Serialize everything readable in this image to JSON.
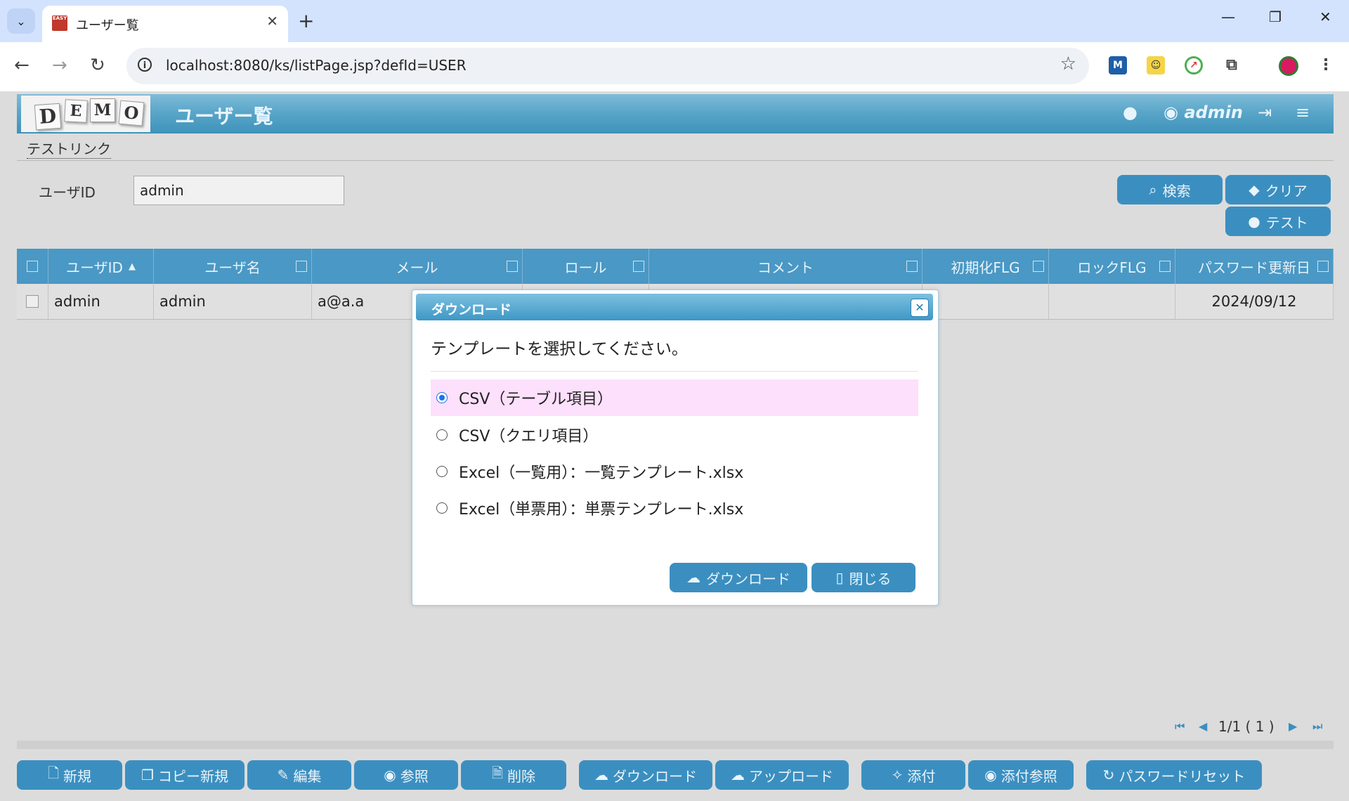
{
  "browser": {
    "tab_title": "ユーザー覧",
    "tab_favicon_text": "EASY",
    "url": "localhost:8080/ks/listPage.jsp?defId=USER"
  },
  "app": {
    "logo_letters": [
      "D",
      "E",
      "M",
      "O"
    ],
    "title": "ユーザー覧",
    "user": "admin",
    "menu_link": "テストリンク"
  },
  "search": {
    "label": "ユーザID",
    "value": "admin",
    "search_button": "検索",
    "clear_button": "クリア",
    "test_button": "テスト"
  },
  "table": {
    "columns": [
      "ユーザID",
      "ユーザ名",
      "メール",
      "ロール",
      "コメント",
      "初期化FLG",
      "ロックFLG",
      "パスワード更新日"
    ],
    "sort_indicator": "▲",
    "rows": [
      [
        "admin",
        "admin",
        "a@a.a",
        "",
        "",
        "",
        "",
        "2024/09/12"
      ]
    ]
  },
  "pager": {
    "text": "1/1 ( 1 )"
  },
  "bottom_buttons": {
    "new": "新規",
    "copy_new": "コピー新規",
    "edit": "編集",
    "view": "参照",
    "delete": "削除",
    "download": "ダウンロード",
    "upload": "アップロード",
    "attach": "添付",
    "attach_view": "添付参照",
    "password_reset": "パスワードリセット"
  },
  "dialog": {
    "title": "ダウンロード",
    "message": "テンプレートを選択してください。",
    "options": [
      "CSV（テーブル項目）",
      "CSV（クエリ項目）",
      "Excel（一覧用）：一覧テンプレート.xlsx",
      "Excel（単票用）：単票テンプレート.xlsx"
    ],
    "selected_index": 0,
    "download_button": "ダウンロード",
    "close_button": "閉じる"
  },
  "colors": {
    "header_blue": "#3e92bb",
    "button_blue": "#3b8fc0",
    "selected_option": "#fde0fc"
  }
}
